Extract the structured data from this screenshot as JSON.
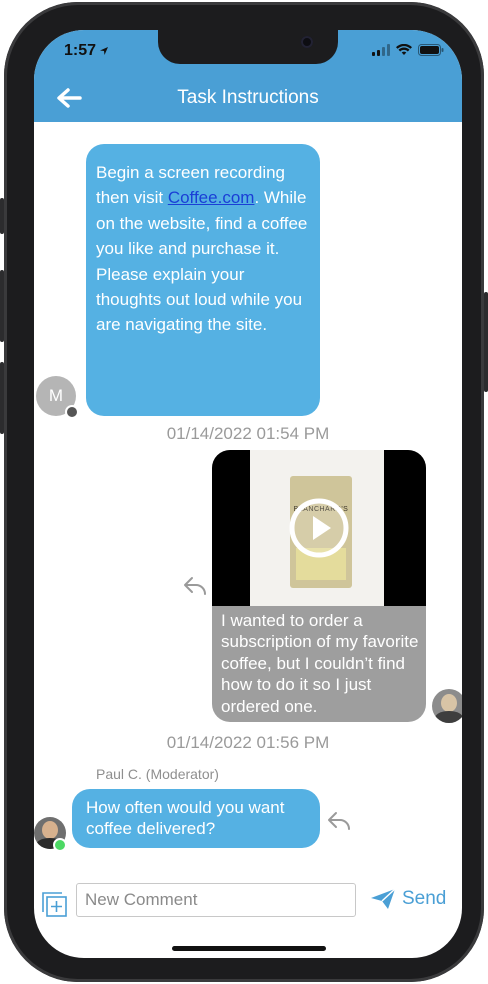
{
  "status_bar": {
    "time": "1:57"
  },
  "header": {
    "title": "Task Instructions"
  },
  "messages": {
    "instruction": {
      "text_before_link": "Begin a screen recording then visit ",
      "link": "Coffee.com",
      "text_after_link": ". While on the website, find a coffee you like and purchase it. Please explain your thoughts out loud while you are navigating the site.",
      "avatar_initial": "M",
      "timestamp": "01/14/2022 01:54 PM"
    },
    "reply_video": {
      "text": "I wanted to order a subscription of my favorite coffee, but I couldn’t find how to do it so I just ordered one.",
      "timestamp": "01/14/2022 01:56 PM",
      "package_label": "BLANCHARD'S"
    },
    "moderator": {
      "sender": "Paul C. (Moderator)",
      "text": "How often would you want coffee delivered?"
    }
  },
  "composer": {
    "placeholder": "New Comment",
    "send_label": "Send"
  },
  "colors": {
    "header": "#4a9fd5",
    "bubble_in": "#55b1e3",
    "bubble_out": "#9e9e9e",
    "timestamp": "#9a9a9a",
    "link": "#1a3fd6",
    "online": "#4cd964"
  }
}
